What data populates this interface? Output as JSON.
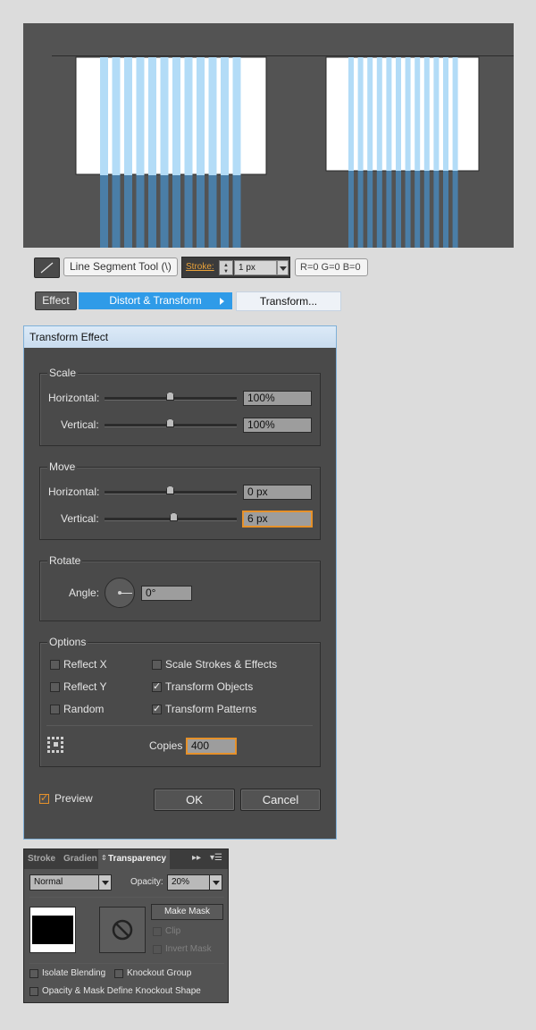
{
  "toolbar": {
    "tool_icon": "line-segment-icon",
    "tool_label": "Line Segment Tool (\\)",
    "stroke_label": "Stroke:",
    "stroke_value": "1 px",
    "color_readout": "R=0 G=0 B=0"
  },
  "menu_path": {
    "effect": "Effect",
    "distort": "Distort & Transform",
    "transform": "Transform..."
  },
  "dialog": {
    "title": "Transform Effect",
    "scale": {
      "title": "Scale",
      "horizontal_label": "Horizontal:",
      "horizontal_value": "100%",
      "vertical_label": "Vertical:",
      "vertical_value": "100%"
    },
    "move": {
      "title": "Move",
      "horizontal_label": "Horizontal:",
      "horizontal_value": "0 px",
      "vertical_label": "Vertical:",
      "vertical_value": "6 px"
    },
    "rotate": {
      "title": "Rotate",
      "angle_label": "Angle:",
      "angle_value": "0°"
    },
    "options": {
      "title": "Options",
      "reflect_x": "Reflect X",
      "reflect_y": "Reflect Y",
      "random": "Random",
      "scale_strokes": "Scale Strokes & Effects",
      "transform_objects": "Transform Objects",
      "transform_patterns": "Transform Patterns",
      "copies_label": "Copies",
      "copies_value": "400"
    },
    "preview_label": "Preview",
    "ok_label": "OK",
    "cancel_label": "Cancel"
  },
  "panel": {
    "tabs": [
      "Stroke",
      "Gradien",
      "Transparency"
    ],
    "blend_mode": "Normal",
    "opacity_label": "Opacity:",
    "opacity_value": "20%",
    "make_mask_label": "Make Mask",
    "clip_label": "Clip",
    "invert_mask_label": "Invert Mask",
    "isolate_blending": "Isolate Blending",
    "knockout_group": "Knockout Group",
    "opacity_mask_define": "Opacity & Mask Define Knockout Shape"
  },
  "colors": {
    "canvas_bg": "#535353",
    "stripe_light": "#b3dcf7",
    "stripe_dark": "#4a7ea7",
    "accent_orange": "#e6912a",
    "menu_highlight": "#2f9be8"
  }
}
